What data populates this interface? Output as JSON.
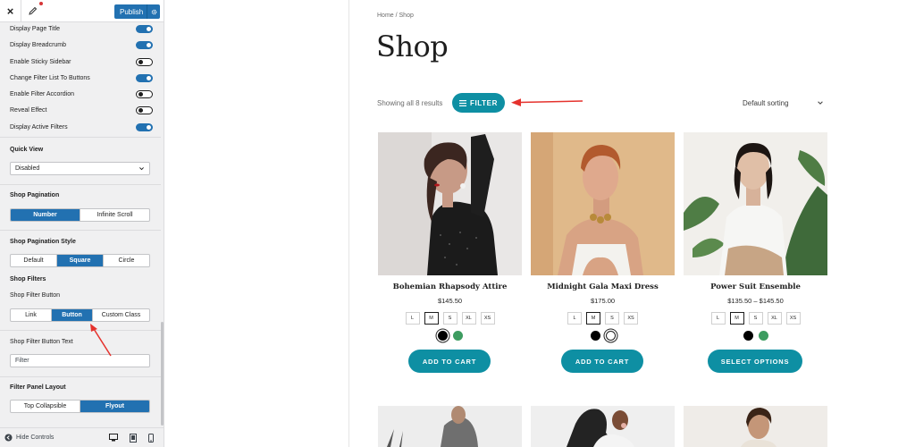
{
  "topbar": {
    "close_label": "×",
    "publish_label": "Publish"
  },
  "toggles": [
    {
      "label": "Display Page Title",
      "state": "on"
    },
    {
      "label": "Display Breadcrumb",
      "state": "on"
    },
    {
      "label": "Enable Sticky Sidebar",
      "state": "off"
    },
    {
      "label": "Change Filter List To Buttons",
      "state": "on"
    },
    {
      "label": "Enable Filter Accordion",
      "state": "off"
    },
    {
      "label": "Reveal Effect",
      "state": "off"
    },
    {
      "label": "Display Active Filters",
      "state": "on"
    }
  ],
  "quick_view": {
    "title": "Quick View",
    "value": "Disabled"
  },
  "pagination": {
    "title": "Shop Pagination",
    "options": [
      "Number",
      "Infinite Scroll"
    ],
    "active": "Number"
  },
  "pagination_style": {
    "title": "Shop Pagination Style",
    "options": [
      "Default",
      "Square",
      "Circle"
    ],
    "active": "Square"
  },
  "filters": {
    "title": "Shop Filters"
  },
  "filter_button": {
    "label": "Shop Filter Button",
    "options": [
      "Link",
      "Button",
      "Custom Class"
    ],
    "active": "Button"
  },
  "filter_button_text": {
    "label": "Shop Filter Button Text",
    "value": "Filter"
  },
  "filter_panel": {
    "title": "Filter Panel Layout",
    "options": [
      "Top Collapsible",
      "Flyout"
    ],
    "active": "Flyout"
  },
  "footer": {
    "hide_label": "Hide Controls"
  },
  "preview": {
    "breadcrumb": "Home / Shop",
    "title": "Shop",
    "results": "Showing all 8 results",
    "filter_label": "FILTER",
    "sorting": "Default sorting"
  },
  "products": [
    {
      "name": "Bohemian Rhapsody Attire",
      "price": "$145.50",
      "sizes": [
        "L",
        "M",
        "S",
        "XL",
        "XS"
      ],
      "selected_size": "M",
      "swatches": [
        {
          "color": "#000000",
          "selected": true
        },
        {
          "color": "#3d9c60",
          "selected": false
        }
      ],
      "button": "ADD TO CART"
    },
    {
      "name": "Midnight Gala Maxi Dress",
      "price": "$175.00",
      "sizes": [
        "L",
        "M",
        "S",
        "XS"
      ],
      "selected_size": "M",
      "swatches": [
        {
          "color": "#000000",
          "selected": false
        },
        {
          "color": "#ffffff",
          "selected": true
        }
      ],
      "button": "ADD TO CART"
    },
    {
      "name": "Power Suit Ensemble",
      "price": "$135.50 – $145.50",
      "sizes": [
        "L",
        "M",
        "S",
        "XL",
        "XS"
      ],
      "selected_size": "M",
      "swatches": [
        {
          "color": "#000000",
          "selected": false
        },
        {
          "color": "#3d9c60",
          "selected": false
        }
      ],
      "button": "SELECT OPTIONS"
    }
  ],
  "colors": {
    "accent": "#0e8fa3",
    "wp_blue": "#2271b1",
    "annotation_red": "#e5322d"
  }
}
